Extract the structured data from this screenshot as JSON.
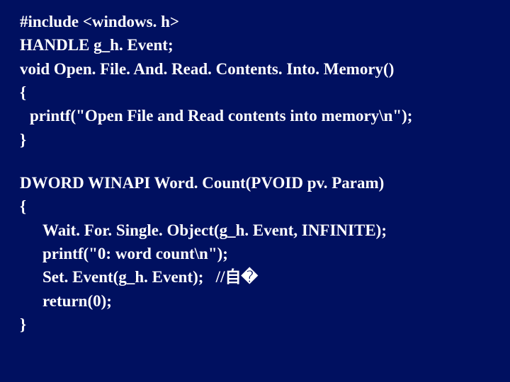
{
  "code": {
    "l1": "#include <windows. h>",
    "l2": "HANDLE g_h. Event;",
    "l3": "void Open. File. And. Read. Contents. Into. Memory()",
    "l4": "{",
    "l5": "printf(\"Open File and Read contents into memory\\n\");",
    "l6": "}",
    "l7": "DWORD WINAPI Word. Count(PVOID pv. Param)",
    "l8": "{",
    "l9": "Wait. For. Single. Object(g_h. Event, INFINITE);",
    "l10": "printf(\"0: word count\\n\");",
    "l11": "Set. Event(g_h. Event);   //自�",
    "l12": "return(0);",
    "l13": "}"
  }
}
